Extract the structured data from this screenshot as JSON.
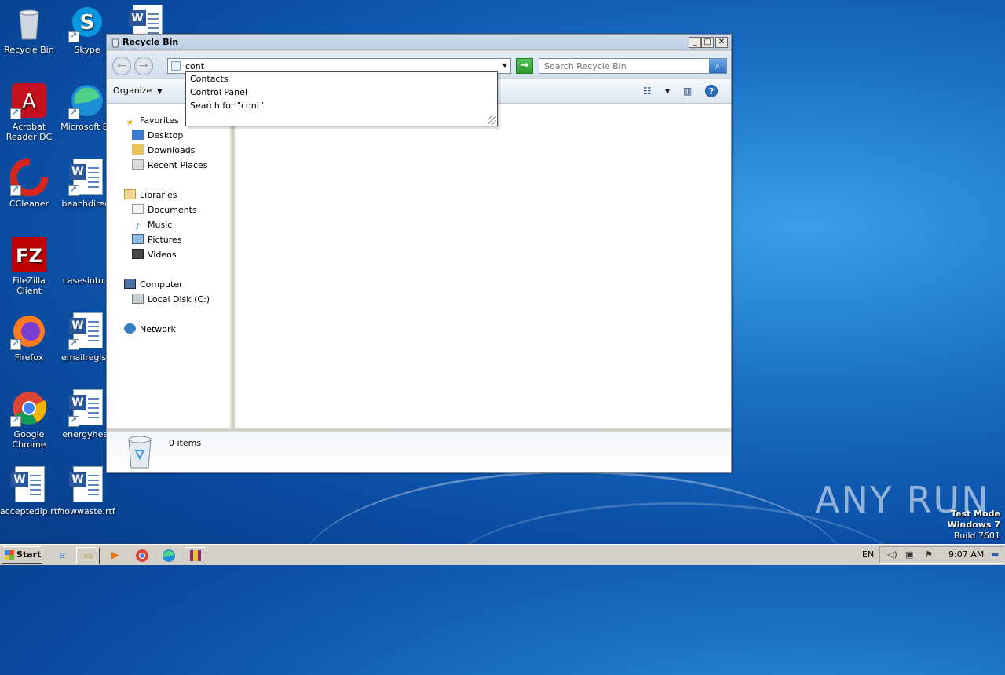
{
  "desktop": {
    "icons": [
      {
        "label": "Recycle Bin",
        "icon": "recycle-bin-icon"
      },
      {
        "label": "Skype",
        "icon": "skype-icon"
      },
      {
        "label": "Acrobat Reader DC",
        "icon": "acrobat-icon"
      },
      {
        "label": "Microsoft Ed",
        "icon": "edge-icon"
      },
      {
        "label": "CCleaner",
        "icon": "ccleaner-icon"
      },
      {
        "label": "beachdirect",
        "icon": "word-document-icon"
      },
      {
        "label": "FileZilla Client",
        "icon": "filezilla-icon"
      },
      {
        "label": "casesinto.p",
        "icon": "document-icon"
      },
      {
        "label": "Firefox",
        "icon": "firefox-icon"
      },
      {
        "label": "emailregistr",
        "icon": "word-document-icon"
      },
      {
        "label": "Google Chrome",
        "icon": "chrome-icon"
      },
      {
        "label": "energyhear",
        "icon": "word-document-icon"
      },
      {
        "label": "acceptedip.rtf",
        "icon": "word-document-icon"
      },
      {
        "label": "howwaste.rtf",
        "icon": "word-document-icon"
      }
    ],
    "watermark": "ANY RUN",
    "test_mode": {
      "line1": "Test Mode",
      "line2": "Windows 7",
      "line3": "Build 7601"
    }
  },
  "window": {
    "title": "Recycle Bin",
    "address_value": "cont",
    "search_placeholder": "Search Recycle Bin",
    "organize_label": "Organize",
    "autocomplete": [
      "Contacts",
      "Control Panel",
      "Search for \"cont\""
    ],
    "nav": {
      "favorites": "Favorites",
      "desktop": "Desktop",
      "downloads": "Downloads",
      "recent": "Recent Places",
      "libraries": "Libraries",
      "documents": "Documents",
      "music": "Music",
      "pictures": "Pictures",
      "videos": "Videos",
      "computer": "Computer",
      "local_disk": "Local Disk (C:)",
      "network": "Network"
    },
    "item_count": "0 items"
  },
  "taskbar": {
    "start_label": "Start",
    "language": "EN",
    "time": "9:07 AM"
  }
}
